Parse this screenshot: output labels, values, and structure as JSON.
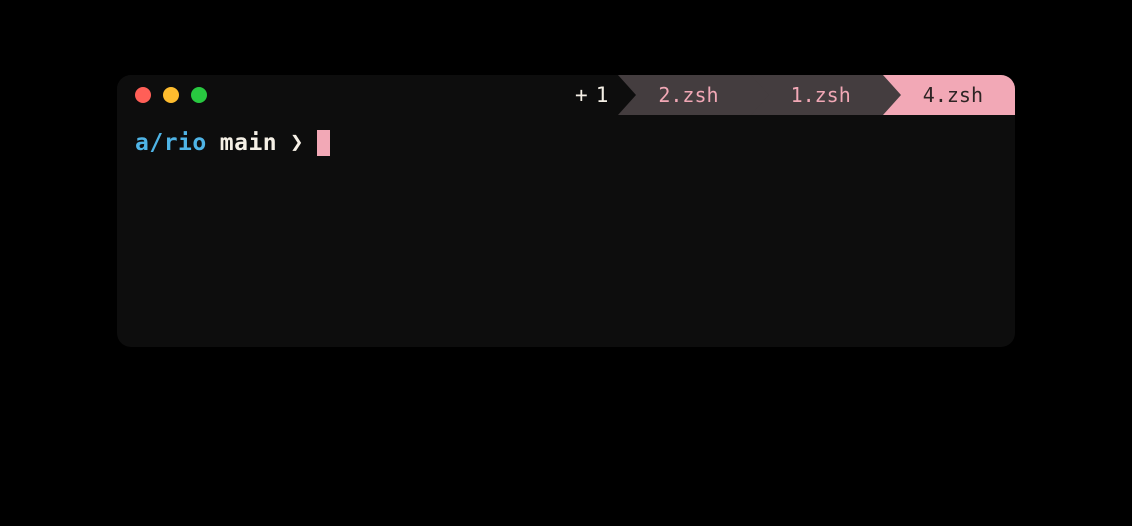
{
  "window": {
    "traffic_lights": {
      "close_color": "#ff5f57",
      "minimize_color": "#febc2e",
      "zoom_color": "#28c840"
    }
  },
  "tabbar": {
    "new_tab_indicator": "+",
    "tab_count": "1",
    "tabs": [
      {
        "label": "2.zsh",
        "active": false
      },
      {
        "label": "1.zsh",
        "active": false
      },
      {
        "label": "4.zsh",
        "active": true
      }
    ]
  },
  "prompt": {
    "path": "a/rio",
    "branch": "main",
    "symbol": "❯"
  },
  "colors": {
    "bg": "#0d0d0d",
    "accent": "#f2a8b6",
    "tab_inactive_bg": "#443d3f",
    "text_light": "#f5f0e6",
    "path_blue": "#4fb4e6"
  }
}
